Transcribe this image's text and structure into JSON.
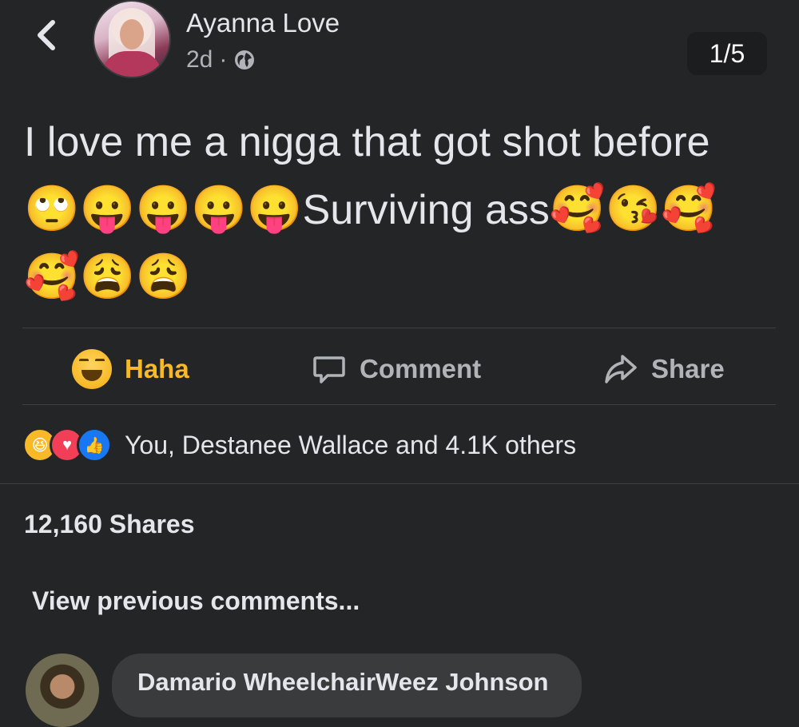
{
  "header": {
    "author_name": "Ayanna Love",
    "time": "2d",
    "separator": "·",
    "privacy_icon": "globe-icon",
    "page_counter": "1/5"
  },
  "post": {
    "text_line1": "I love me a nigga that got shot before",
    "emoji_group1": "🙄😛😛😛😛",
    "text_line2": "Surviving ass",
    "emoji_group2": "🥰😘🥰",
    "emoji_group3": "🥰😩😩"
  },
  "actions": {
    "haha_label": "Haha",
    "comment_label": "Comment",
    "share_label": "Share"
  },
  "reactions": {
    "types": [
      "haha",
      "love",
      "like"
    ],
    "summary": "You, Destanee Wallace and 4.1K others"
  },
  "shares": "12,160 Shares",
  "comments": {
    "view_previous": "View previous comments...",
    "first_commenter": "Damario WheelchairWeez Johnson"
  },
  "colors": {
    "background": "#242526",
    "haha_accent": "#f7b928",
    "secondary_text": "#b0b3b8"
  }
}
